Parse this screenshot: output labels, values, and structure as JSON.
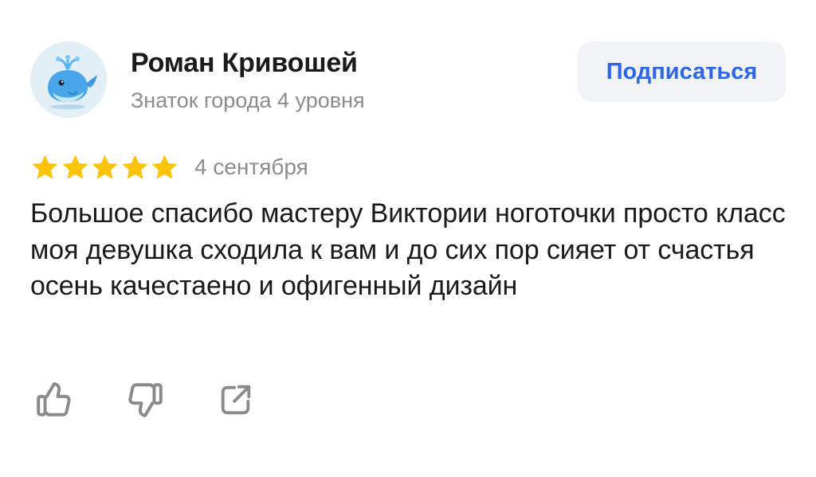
{
  "author": {
    "name": "Роман Кривошей",
    "level": "Знаток города 4 уровня",
    "avatar_icon": "whale-icon"
  },
  "subscribe": {
    "label": "Подписаться",
    "color": "#2d66e8",
    "background": "#f1f3f6"
  },
  "review": {
    "rating": 5,
    "rating_max": 5,
    "star_color": "#fcc30b",
    "date": "4 сентября",
    "text": "Большое спасибо мастеру Виктории ноготочки просто класс моя девушка сходила к вам и до сих пор сияет от счастья осень качестаено и офигенный дизайн"
  },
  "actions": [
    {
      "name": "like",
      "icon": "thumbs-up-icon"
    },
    {
      "name": "dislike",
      "icon": "thumbs-down-icon"
    },
    {
      "name": "share",
      "icon": "share-icon"
    }
  ]
}
